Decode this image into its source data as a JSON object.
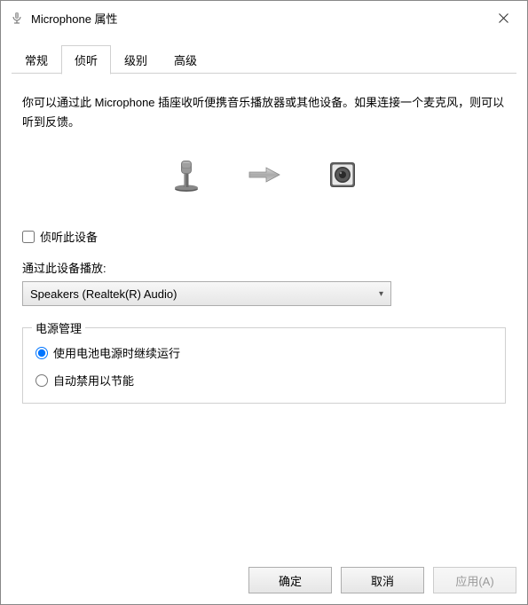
{
  "title": "Microphone 属性",
  "tabs": {
    "general": "常规",
    "listen": "侦听",
    "levels": "级别",
    "advanced": "高级"
  },
  "description": "你可以通过此 Microphone 插座收听便携音乐播放器或其他设备。如果连接一个麦克风，则可以听到反馈。",
  "checkbox": {
    "listen_label": "侦听此设备"
  },
  "playback": {
    "label": "通过此设备播放:",
    "selected": "Speakers (Realtek(R) Audio)"
  },
  "power": {
    "group_title": "电源管理",
    "option_continue": "使用电池电源时继续运行",
    "option_disable": "自动禁用以节能"
  },
  "buttons": {
    "ok": "确定",
    "cancel": "取消",
    "apply": "应用(A)"
  }
}
